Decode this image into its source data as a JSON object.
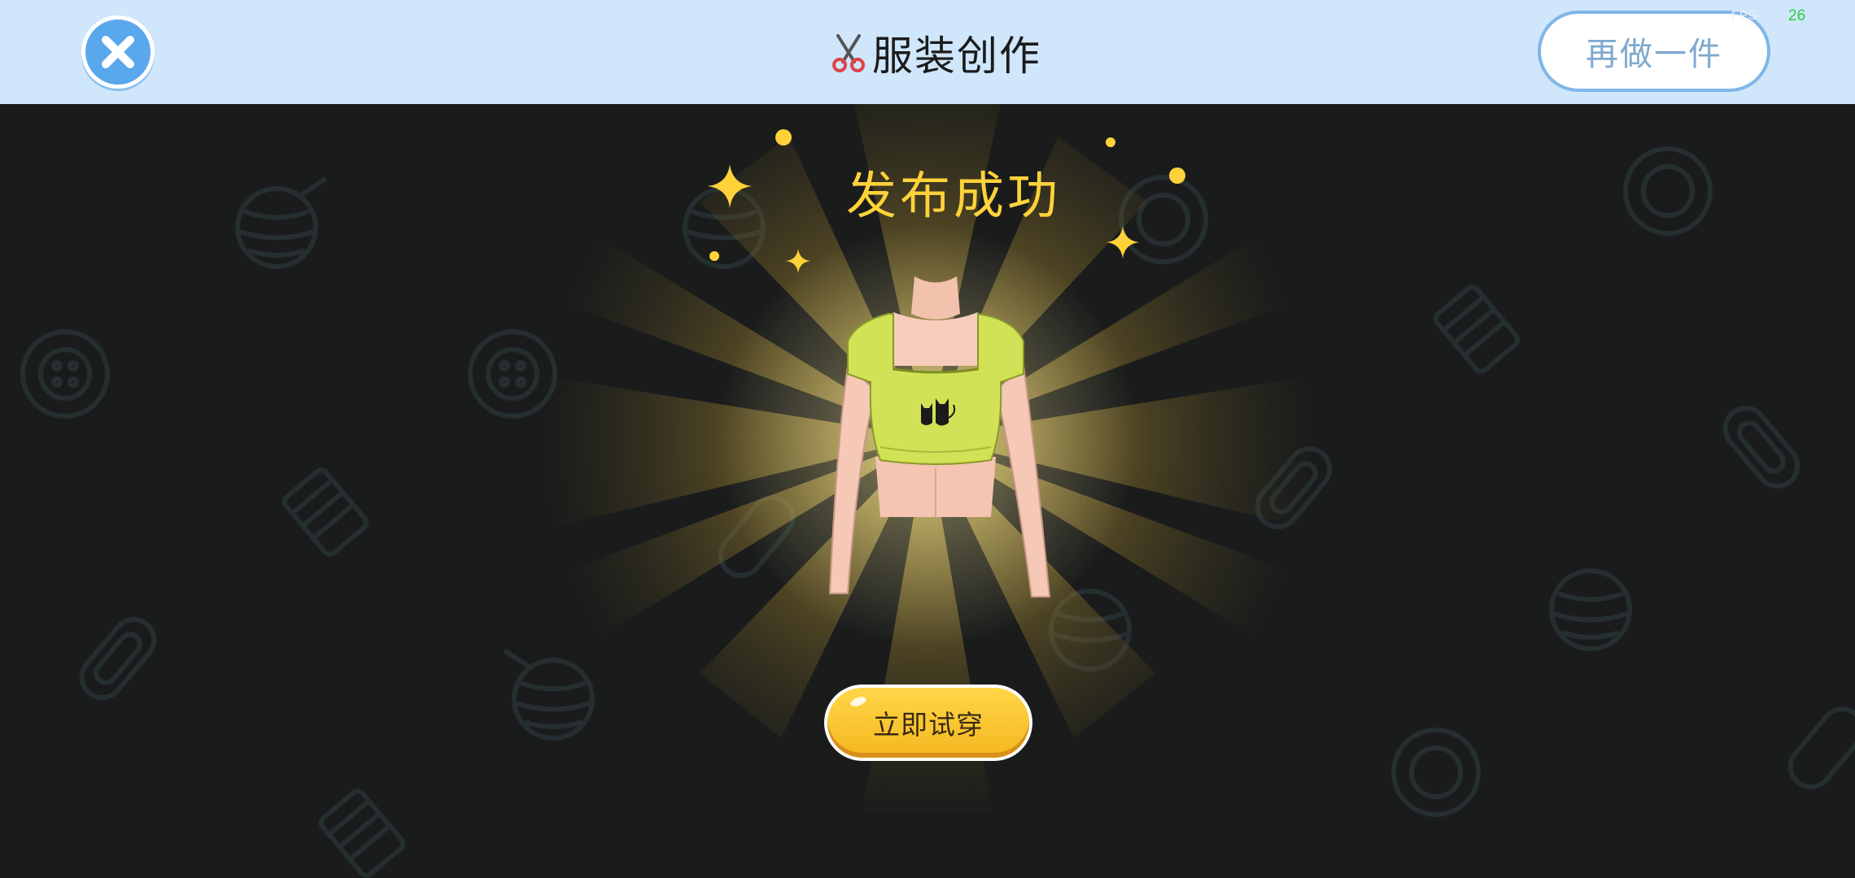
{
  "header": {
    "title": "服装创作",
    "again_label": "再做一件",
    "fps_label": "FPS",
    "fps_value": "26"
  },
  "icons": {
    "close": "close-icon",
    "title": "scissors-icon",
    "background": [
      "yarn-ball-icon",
      "button-icon",
      "spool-icon",
      "paperclip-icon"
    ]
  },
  "result": {
    "title": "发布成功",
    "try_on_label": "立即试穿",
    "garment": "yellow crop top with black cats print"
  },
  "colors": {
    "header_bg": "#cfe6fb",
    "close_btn": "#5aa8ec",
    "accent_yellow": "#ffd23a",
    "page_bg": "#1a1c1c",
    "garment": "#d2e256"
  }
}
